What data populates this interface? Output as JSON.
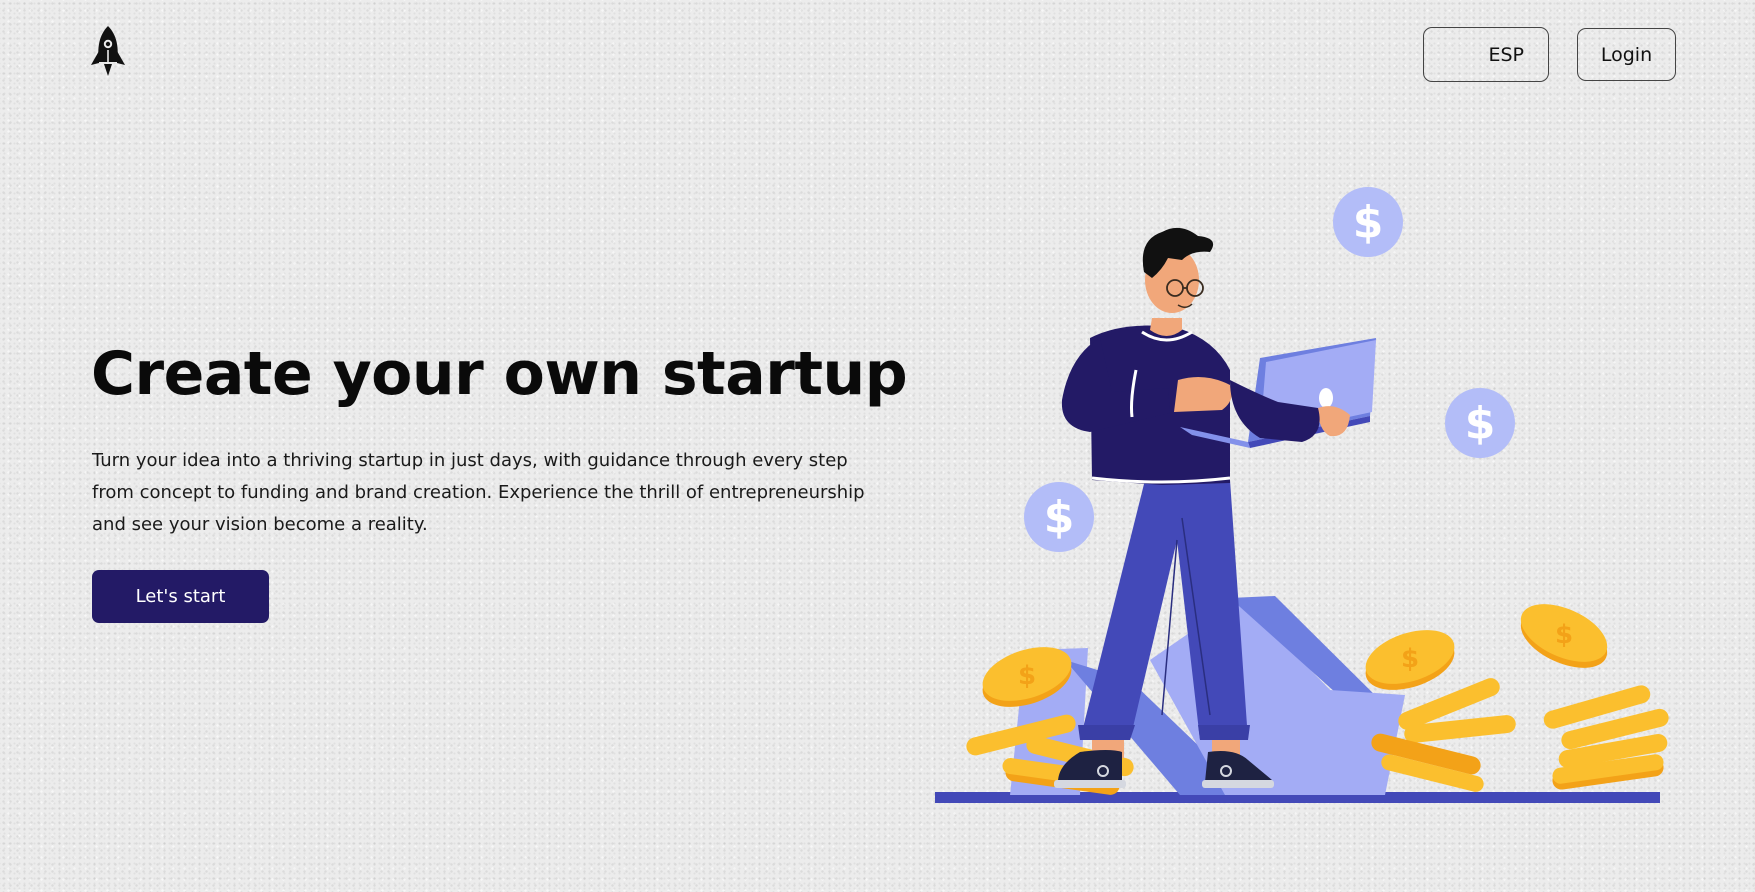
{
  "header": {
    "logo_icon": "rocket-icon",
    "language_label": "ESP",
    "login_label": "Login"
  },
  "hero": {
    "title": "Create your own startup",
    "description": "Turn your idea into a thriving startup in just days, with guidance through every step from concept to funding and brand creation. Experience the thrill of entrepreneurship and see your vision become a reality.",
    "cta_label": "Let's start"
  },
  "illustration": {
    "icon": "startup-person-with-laptop-and-coins-illustration",
    "coin_symbol": "$",
    "colors": {
      "navy": "#231a66",
      "indigo": "#4349b8",
      "periwinkle": "#a3acf5",
      "coin_gold": "#fbbf2e",
      "coin_orange": "#f3a218",
      "bubble": "#b3bdf8"
    }
  },
  "theme": {
    "background": "#ececec",
    "button_color": "#231a66"
  }
}
